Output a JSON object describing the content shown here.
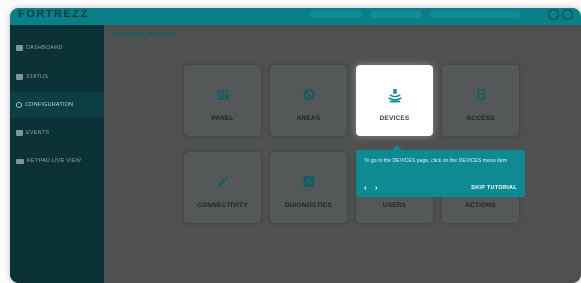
{
  "app": {
    "logo_text": "FORTREZZ"
  },
  "sidebar": {
    "items": [
      {
        "label": "DASHBOARD",
        "icon": "dashboard-icon"
      },
      {
        "label": "STATUS",
        "icon": "status-icon"
      },
      {
        "label": "CONFIGURATION",
        "icon": "gear-icon",
        "active": true
      },
      {
        "label": "EVENTS",
        "icon": "events-icon"
      },
      {
        "label": "KEYPAD LIVE VIEW",
        "icon": "keypad-icon"
      }
    ]
  },
  "main": {
    "title": "CONFIGURATION",
    "tiles": [
      {
        "label": "PANEL",
        "icon": "panel-icon"
      },
      {
        "label": "AREAS",
        "icon": "areas-icon"
      },
      {
        "label": "DEVICES",
        "icon": "devices-icon",
        "highlighted": true
      },
      {
        "label": "ACCESS",
        "icon": "access-icon"
      },
      {
        "label": "CONNECTIVITY",
        "icon": "connectivity-icon"
      },
      {
        "label": "DIAGNOSTICS",
        "icon": "diagnostics-icon"
      },
      {
        "label": "USERS",
        "icon": "users-icon"
      },
      {
        "label": "ACTIONS",
        "icon": "actions-icon"
      }
    ]
  },
  "tooltip": {
    "text": "To go to the DEVICES page, click on the DEVICES menu item",
    "prev": "‹",
    "next": "›",
    "skip_label": "SKIP TUTORIAL"
  },
  "colors": {
    "accent": "#0e8a93",
    "sidebar_bg": "#0b3236",
    "tile_icon": "#0b5f66"
  }
}
